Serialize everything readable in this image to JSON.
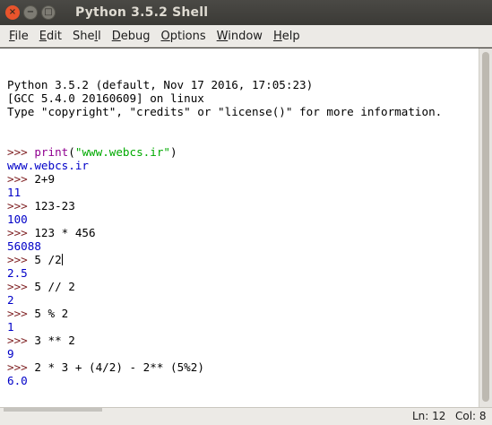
{
  "window": {
    "title": "Python 3.5.2 Shell",
    "controls": [
      "close-icon",
      "minimize-icon",
      "maximize-icon"
    ],
    "close_glyph": "×",
    "min_glyph": "−",
    "max_glyph": "□"
  },
  "menu": [
    {
      "u": "F",
      "rest": "ile"
    },
    {
      "u": "E",
      "rest": "dit"
    },
    {
      "pre": "She",
      "u": "l",
      "rest": "l"
    },
    {
      "u": "D",
      "rest": "ebug"
    },
    {
      "u": "O",
      "rest": "ptions"
    },
    {
      "u": "W",
      "rest": "indow"
    },
    {
      "u": "H",
      "rest": "elp"
    }
  ],
  "shell": {
    "banner": [
      "Python 3.5.2 (default, Nov 17 2016, 17:05:23)",
      "[GCC 5.4.0 20160609] on linux",
      "Type \"copyright\", \"credits\" or \"license()\" for more information."
    ],
    "prompt": ">>> ",
    "entries": [
      {
        "input": [
          {
            "t": "print",
            "c": "builtin"
          },
          {
            "t": "(",
            "c": "code"
          },
          {
            "t": "\"www.webcs.ir\"",
            "c": "str"
          },
          {
            "t": ")",
            "c": "code"
          }
        ],
        "output": "www.webcs.ir"
      },
      {
        "input": [
          {
            "t": "2+9",
            "c": "code"
          }
        ],
        "output": "11"
      },
      {
        "input": [
          {
            "t": "123-23",
            "c": "code"
          }
        ],
        "output": "100"
      },
      {
        "input": [
          {
            "t": "123 * 456",
            "c": "code"
          }
        ],
        "output": "56088"
      },
      {
        "input": [
          {
            "t": "5 /2",
            "c": "code"
          }
        ],
        "output": "2.5",
        "cursor": true
      },
      {
        "input": [
          {
            "t": "5 // 2",
            "c": "code"
          }
        ],
        "output": "2"
      },
      {
        "input": [
          {
            "t": "5 % 2",
            "c": "code"
          }
        ],
        "output": "1"
      },
      {
        "input": [
          {
            "t": "3 ** 2",
            "c": "code"
          }
        ],
        "output": "9"
      },
      {
        "input": [
          {
            "t": "2 * 3 + (4/2) - 2** (5%2)",
            "c": "code"
          }
        ],
        "output": "6.0"
      }
    ],
    "final_prompt": ">>>"
  },
  "status": {
    "line": "Ln: 12",
    "col": "Col: 8"
  },
  "colors": {
    "prompt": "#7d1d1f",
    "output": "#0000c8",
    "string": "#00aa00",
    "builtin": "#900090"
  }
}
